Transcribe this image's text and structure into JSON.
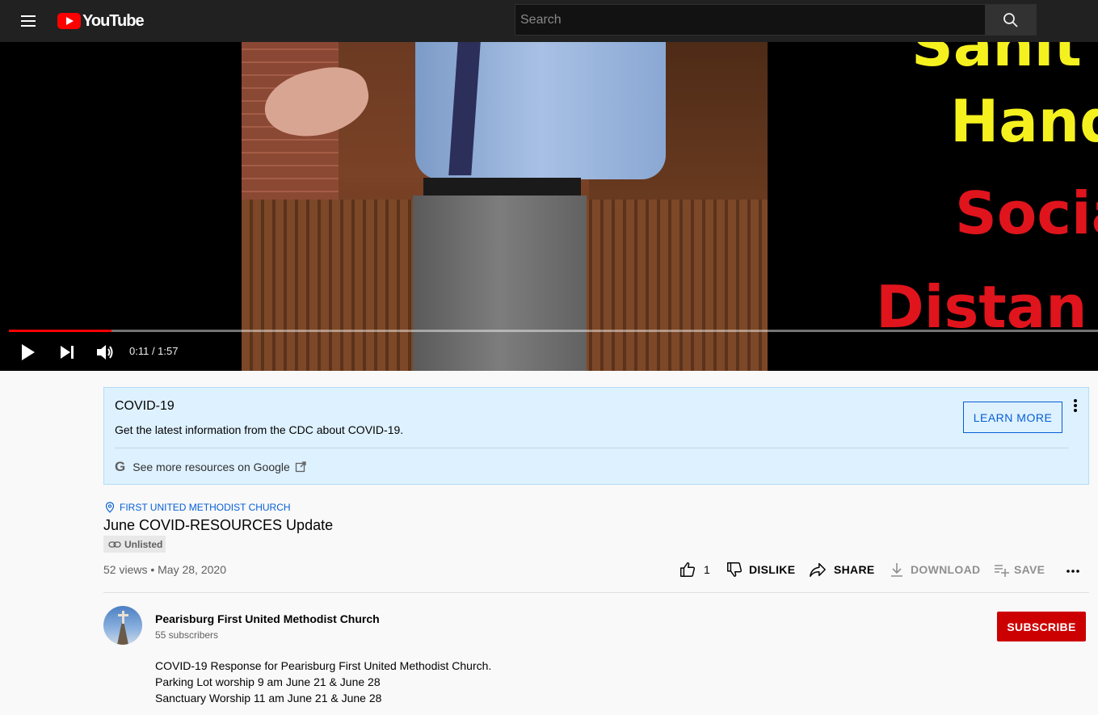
{
  "masthead": {
    "logo_text": "YouTube",
    "search_placeholder": "Search"
  },
  "player": {
    "slide_lines": [
      "Sanit",
      "Hand",
      "Socia",
      "Distan"
    ],
    "current_time": "0:11",
    "duration": "1:57",
    "time_display": "0:11 / 1:57",
    "progress_fraction": 0.094,
    "colors": {
      "progress": "#ff0000",
      "slide_yellow": "#f5f11f",
      "slide_red": "#e0141c"
    }
  },
  "notice": {
    "title": "COVID-19",
    "subtitle": "Get the latest information from the CDC about COVID-19.",
    "google_link": "See more resources on Google",
    "learn_more": "LEARN MORE"
  },
  "video": {
    "location": "FIRST UNITED METHODIST CHURCH",
    "title": "June COVID-RESOURCES Update",
    "badge": "Unlisted",
    "meta": "52 views • May 28, 2020"
  },
  "actions": {
    "likes": "1",
    "dislike": "DISLIKE",
    "share": "SHARE",
    "download": "DOWNLOAD",
    "save": "SAVE"
  },
  "channel": {
    "name": "Pearisburg First United Methodist Church",
    "subscribers": "55 subscribers",
    "subscribe_label": "SUBSCRIBE"
  },
  "description": [
    "COVID-19 Response for Pearisburg First United Methodist Church.",
    "Parking Lot worship 9 am June 21 & June 28",
    "Sanctuary Worship 11 am June 21 & June 28"
  ]
}
